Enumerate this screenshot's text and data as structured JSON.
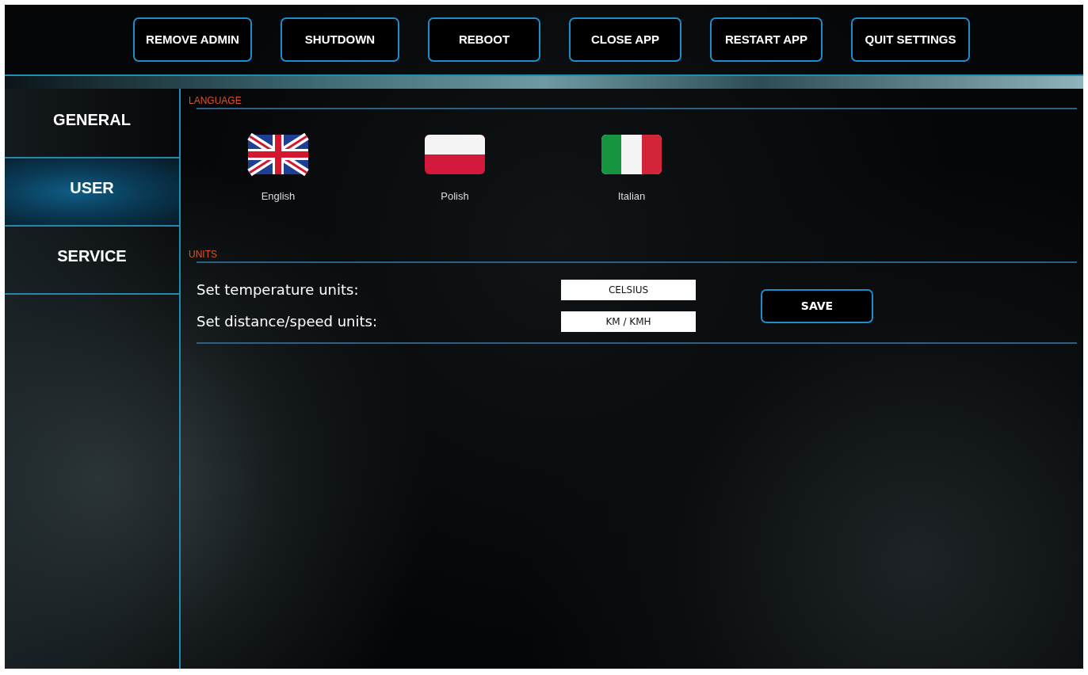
{
  "top_buttons": [
    "REMOVE ADMIN",
    "SHUTDOWN",
    "REBOOT",
    "CLOSE APP",
    "RESTART APP",
    "QUIT SETTINGS"
  ],
  "sidebar": {
    "items": [
      {
        "label": "GENERAL",
        "selected": false
      },
      {
        "label": "USER",
        "selected": true
      },
      {
        "label": "SERVICE",
        "selected": false
      }
    ]
  },
  "language": {
    "heading": "LANGUAGE",
    "options": [
      {
        "kind": "uk",
        "label": "English"
      },
      {
        "kind": "pl",
        "label": "Polish"
      },
      {
        "kind": "it",
        "label": "Italian"
      }
    ]
  },
  "units": {
    "heading": "UNITS",
    "rows": [
      {
        "label": "Set temperature units:",
        "value": "CELSIUS"
      },
      {
        "label": "Set distance/speed units:",
        "value": "KM / KMH"
      }
    ],
    "save_button": "SAVE"
  }
}
